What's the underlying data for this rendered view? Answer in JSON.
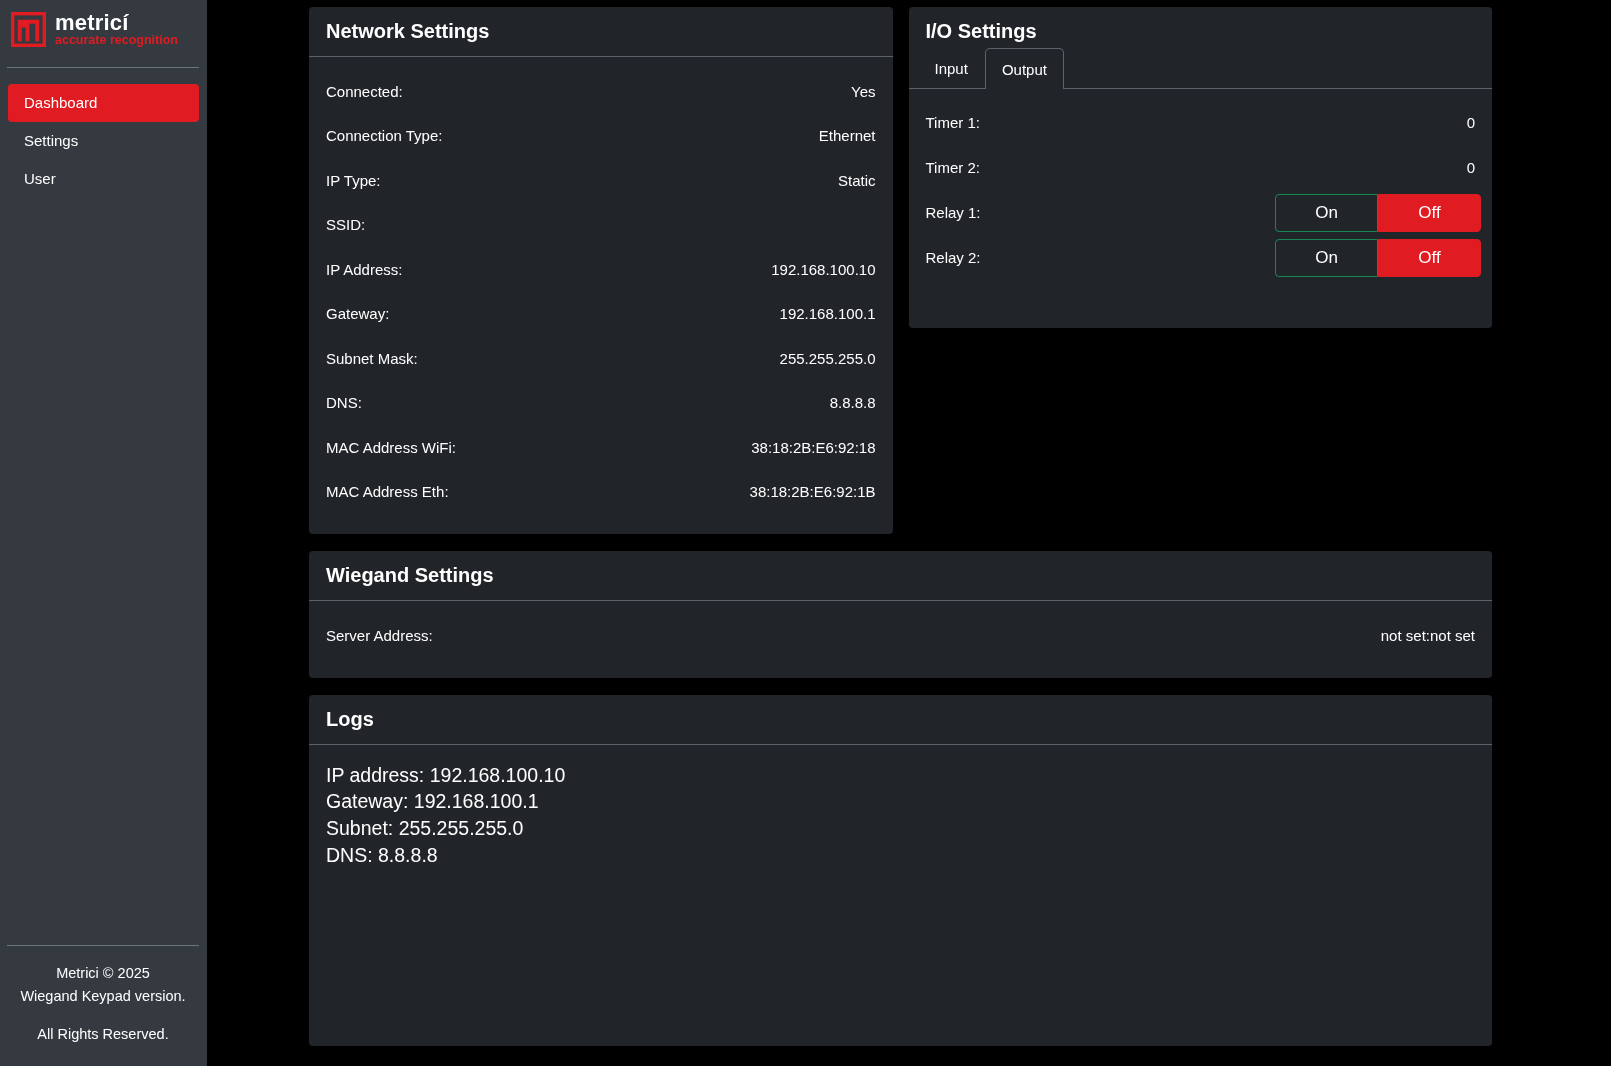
{
  "sidebar": {
    "logo": {
      "name": "metricí",
      "tagline": "accurate recognition"
    },
    "items": [
      {
        "label": "Dashboard",
        "selected": true
      },
      {
        "label": "Settings",
        "selected": false
      },
      {
        "label": "User",
        "selected": false
      }
    ],
    "footer": [
      {
        "lines": [
          "Metrici © 2025",
          "Wiegand Keypad version."
        ]
      },
      {
        "lines": [
          "All Rights Reserved."
        ]
      }
    ]
  },
  "network_settings": {
    "title": "Network Settings",
    "rows": [
      {
        "label": "Connected:",
        "value": "Yes"
      },
      {
        "label": "Connection Type:",
        "value": "Ethernet"
      },
      {
        "label": "IP Type:",
        "value": "Static"
      },
      {
        "label": "SSID:"
      },
      {
        "label": "IP Address:",
        "value": "192.168.100.10"
      },
      {
        "label": "Gateway:",
        "value": "192.168.100.1"
      },
      {
        "label": "Subnet Mask:",
        "value": "255.255.255.0"
      },
      {
        "label": "DNS:",
        "value": "8.8.8.8"
      },
      {
        "label": "MAC Address WiFi:",
        "value": "38:18:2B:E6:92:18"
      },
      {
        "label": "MAC Address Eth:",
        "value": "38:18:2B:E6:92:1B"
      }
    ]
  },
  "io_settings": {
    "title": "I/O Settings",
    "tabs": [
      {
        "label": "Input",
        "selected": false
      },
      {
        "label": "Output",
        "selected": true
      }
    ],
    "rows": [
      {
        "kind": "value",
        "label": "Timer 1:",
        "value": "0"
      },
      {
        "kind": "value",
        "label": "Timer 2:",
        "value": "0"
      },
      {
        "kind": "toggle",
        "label": "Relay 1:",
        "options": [
          {
            "kind": "on",
            "label": "On",
            "selected": false
          },
          {
            "kind": "off",
            "label": "Off",
            "selected": true
          }
        ]
      },
      {
        "kind": "toggle",
        "label": "Relay 2:",
        "options": [
          {
            "kind": "on",
            "label": "On",
            "selected": false
          },
          {
            "kind": "off",
            "label": "Off",
            "selected": true
          }
        ]
      }
    ]
  },
  "wiegand_settings": {
    "title": "Wiegand Settings",
    "rows": [
      {
        "label": "Server Address:",
        "value": "not set:not set"
      }
    ]
  },
  "logs": {
    "title": "Logs",
    "lines": [
      "IP address: 192.168.100.10",
      "Gateway: 192.168.100.1",
      "Subnet: 255.255.255.0",
      "DNS: 8.8.8.8"
    ]
  }
}
